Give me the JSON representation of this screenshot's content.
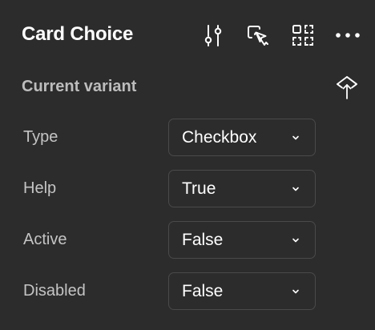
{
  "header": {
    "title": "Card Choice",
    "actions": [
      {
        "name": "adjust-properties-button",
        "icon": "sliders-icon"
      },
      {
        "name": "select-instance-button",
        "icon": "cursor-select-icon"
      },
      {
        "name": "component-grid-button",
        "icon": "dashed-grid-icon"
      },
      {
        "name": "more-options-button",
        "icon": "more-horizontal-icon"
      }
    ]
  },
  "section": {
    "title": "Current variant",
    "action_icon": "detach-icon"
  },
  "properties": [
    {
      "label": "Type",
      "value": "Checkbox"
    },
    {
      "label": "Help",
      "value": "True"
    },
    {
      "label": "Active",
      "value": "False"
    },
    {
      "label": "Disabled",
      "value": "False"
    }
  ],
  "colors": {
    "background": "#2c2c2c",
    "title": "#ffffff",
    "label": "#c4c4c4",
    "section_title": "#bdbdbd",
    "select_border": "#4a4a4a"
  }
}
